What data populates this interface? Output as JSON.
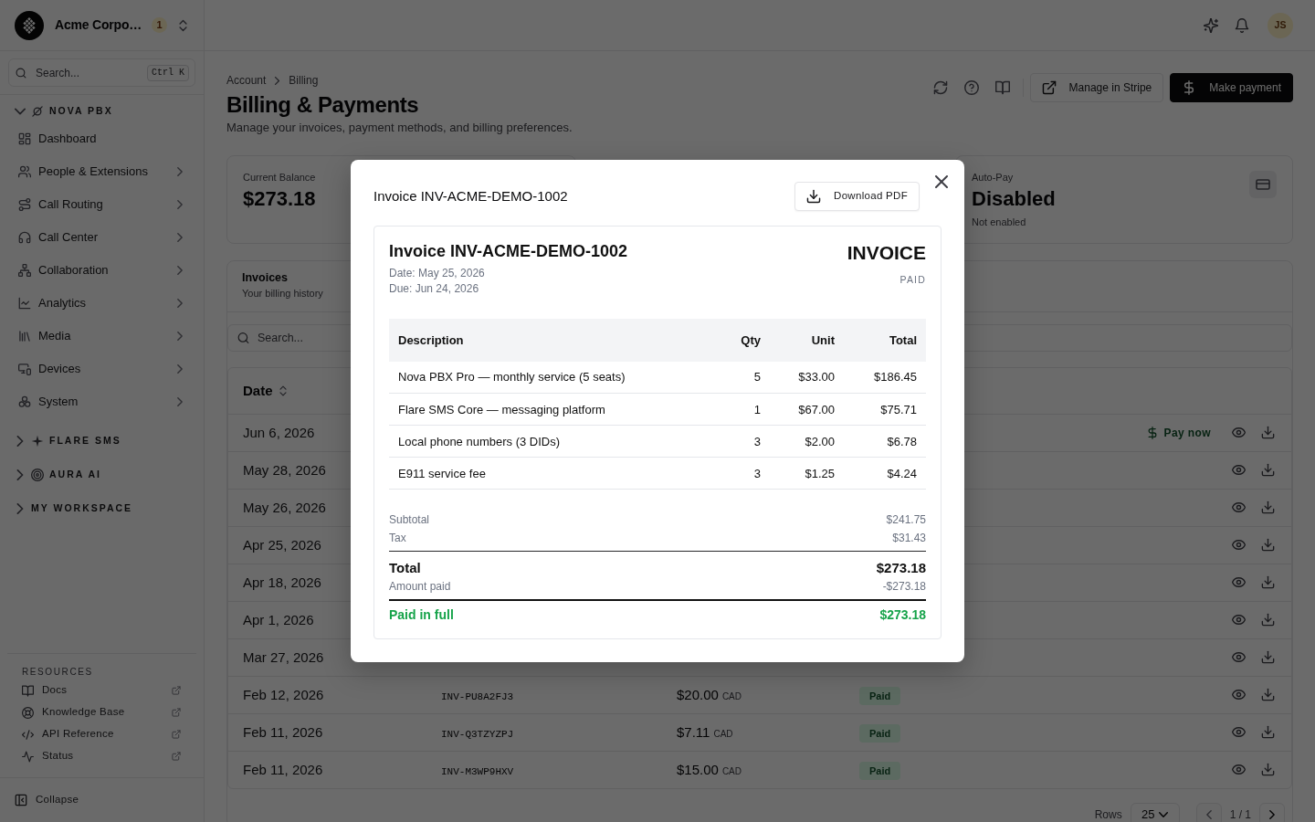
{
  "sidebar": {
    "org": {
      "name": "Acme Corpo…",
      "badge": "1"
    },
    "search": {
      "placeholder": "Search...",
      "shortcut": "Ctrl K"
    },
    "sections": [
      {
        "title": "NOVA PBX",
        "expanded": true,
        "items": [
          {
            "label": "Dashboard",
            "expandable": false,
            "selected": false
          },
          {
            "label": "People & Extensions",
            "expandable": true,
            "selected": false
          },
          {
            "label": "Call Routing",
            "expandable": true,
            "selected": false
          },
          {
            "label": "Call Center",
            "expandable": true,
            "selected": false
          },
          {
            "label": "Collaboration",
            "expandable": true,
            "selected": false
          },
          {
            "label": "Analytics",
            "expandable": true,
            "selected": false
          },
          {
            "label": "Media",
            "expandable": true,
            "selected": false
          },
          {
            "label": "Devices",
            "expandable": true,
            "selected": false
          },
          {
            "label": "System",
            "expandable": true,
            "selected": false
          }
        ]
      },
      {
        "title": "FLARE SMS",
        "expanded": false
      },
      {
        "title": "AURA AI",
        "expanded": false
      },
      {
        "title": "MY WORKSPACE",
        "expanded": false
      }
    ],
    "resources": {
      "title": "RESOURCES",
      "items": [
        "Docs",
        "Knowledge Base",
        "API Reference",
        "Status"
      ]
    },
    "collapse": "Collapse"
  },
  "topbar": {
    "avatar": "JS"
  },
  "page": {
    "breadcrumb": [
      "Account",
      "Billing"
    ],
    "title": "Billing & Payments",
    "subtitle": "Manage your invoices, payment methods, and billing preferences.",
    "actions": [
      {
        "label": "Manage in Stripe",
        "kind": "outline"
      },
      {
        "label": "Make payment",
        "kind": "primary"
      }
    ]
  },
  "stats": [
    {
      "label": "Current Balance",
      "value": "$273.18"
    },
    {
      "label": "Auto-Pay",
      "value": "Disabled",
      "note": "Not enabled"
    }
  ],
  "invoices": {
    "title": "Invoices",
    "subtitle": "Your billing history",
    "search": {
      "placeholder": "Search..."
    },
    "columns": [
      {
        "label": "Date",
        "sortable": true
      }
    ],
    "rows": [
      {
        "date": "Jun 6, 2026",
        "pay_now": "Pay now"
      },
      {
        "date": "May 28, 2026"
      },
      {
        "date": "May 26, 2026"
      },
      {
        "date": "Apr 25, 2026"
      },
      {
        "date": "Apr 18, 2026"
      },
      {
        "date": "Apr 1, 2026"
      },
      {
        "date": "Mar 27, 2026"
      },
      {
        "date": "Feb 12, 2026",
        "invoice": "INV-PU8A2FJ3",
        "amount": "$20.00",
        "currency": "CAD",
        "status": "Paid"
      },
      {
        "date": "Feb 11, 2026",
        "invoice": "INV-Q3TZYZPJ",
        "amount": "$7.11",
        "currency": "CAD",
        "status": "Paid"
      },
      {
        "date": "Feb 11, 2026",
        "invoice": "INV-M3WP9HXV",
        "amount": "$15.00",
        "currency": "CAD",
        "status": "Paid"
      }
    ],
    "pagination": {
      "label": "Rows",
      "page_size": "25",
      "page": "1 / 1",
      "previous": {
        "disabled": true
      },
      "next": {
        "disabled": false
      }
    }
  },
  "modal": {
    "title": "Invoice INV-ACME-DEMO-1002",
    "download": "Download PDF",
    "document": {
      "title": "Invoice INV-ACME-DEMO-1002",
      "date": "Date: May 25, 2026",
      "due": "Due: Jun 24, 2026",
      "heading": "INVOICE",
      "status": "PAID",
      "columns": [
        "Description",
        "Qty",
        "Unit",
        "Total"
      ],
      "lines": [
        {
          "description": "Nova PBX Pro — monthly service (5 seats)",
          "qty": "5",
          "unit": "$33.00",
          "total": "$186.45"
        },
        {
          "description": "Flare SMS Core — messaging platform",
          "qty": "1",
          "unit": "$67.00",
          "total": "$75.71"
        },
        {
          "description": "Local phone numbers (3 DIDs)",
          "qty": "3",
          "unit": "$2.00",
          "total": "$6.78"
        },
        {
          "description": "E911 service fee",
          "qty": "3",
          "unit": "$1.25",
          "total": "$4.24"
        }
      ],
      "summary": [
        {
          "label": "Subtotal",
          "value": "$241.75",
          "kind": "minor"
        },
        {
          "label": "Tax",
          "value": "$31.43",
          "kind": "minor"
        },
        {
          "label": "Total",
          "value": "$273.18",
          "kind": "total"
        },
        {
          "label": "Amount paid",
          "value": "-$273.18",
          "kind": "minor"
        },
        {
          "label": "Paid in full",
          "value": "$273.18",
          "kind": "balance"
        }
      ]
    }
  }
}
